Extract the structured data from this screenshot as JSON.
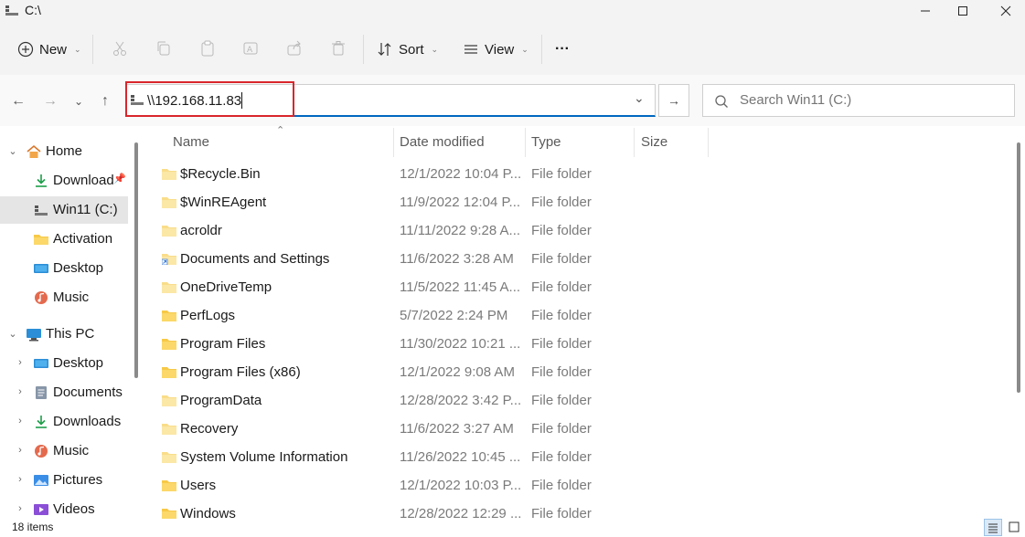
{
  "window": {
    "title": "C:\\"
  },
  "toolbar": {
    "new_label": "New",
    "sort_label": "Sort",
    "view_label": "View",
    "more_label": "···"
  },
  "address": {
    "value": "\\\\192.168.11.83",
    "go_label": "→"
  },
  "search": {
    "placeholder": "Search Win11 (C:)"
  },
  "sidebar": {
    "items": [
      {
        "label": "Home",
        "icon": "home-icon"
      },
      {
        "label": "Downloads",
        "icon": "download-icon",
        "pinned": true
      },
      {
        "label": "Win11 (C:)",
        "icon": "drive-icon",
        "selected": true
      },
      {
        "label": "Activation",
        "icon": "folder-icon"
      },
      {
        "label": "Desktop",
        "icon": "desktop-icon"
      },
      {
        "label": "Music",
        "icon": "music-icon"
      },
      {
        "label": "This PC",
        "icon": "pc-icon"
      },
      {
        "label": "Desktop",
        "icon": "desktop-icon"
      },
      {
        "label": "Documents",
        "icon": "documents-icon"
      },
      {
        "label": "Downloads",
        "icon": "download-icon"
      },
      {
        "label": "Music",
        "icon": "music-icon"
      },
      {
        "label": "Pictures",
        "icon": "pictures-icon"
      },
      {
        "label": "Videos",
        "icon": "videos-icon"
      }
    ]
  },
  "columns": {
    "name": "Name",
    "date": "Date modified",
    "type": "Type",
    "size": "Size"
  },
  "files": [
    {
      "name": "$Recycle.Bin",
      "date": "12/1/2022 10:04 P...",
      "type": "File folder",
      "faded": true
    },
    {
      "name": "$WinREAgent",
      "date": "11/9/2022 12:04 P...",
      "type": "File folder",
      "faded": true
    },
    {
      "name": "acroldr",
      "date": "11/11/2022 9:28 A...",
      "type": "File folder",
      "faded": true
    },
    {
      "name": "Documents and Settings",
      "date": "11/6/2022 3:28 AM",
      "type": "File folder",
      "faded": true,
      "shortcut": true
    },
    {
      "name": "OneDriveTemp",
      "date": "11/5/2022 11:45 A...",
      "type": "File folder",
      "faded": true
    },
    {
      "name": "PerfLogs",
      "date": "5/7/2022 2:24 PM",
      "type": "File folder"
    },
    {
      "name": "Program Files",
      "date": "11/30/2022 10:21 ...",
      "type": "File folder"
    },
    {
      "name": "Program Files (x86)",
      "date": "12/1/2022 9:08 AM",
      "type": "File folder"
    },
    {
      "name": "ProgramData",
      "date": "12/28/2022 3:42 P...",
      "type": "File folder",
      "faded": true
    },
    {
      "name": "Recovery",
      "date": "11/6/2022 3:27 AM",
      "type": "File folder",
      "faded": true
    },
    {
      "name": "System Volume Information",
      "date": "11/26/2022 10:45 ...",
      "type": "File folder",
      "faded": true
    },
    {
      "name": "Users",
      "date": "12/1/2022 10:03 P...",
      "type": "File folder"
    },
    {
      "name": "Windows",
      "date": "12/28/2022 12:29 ...",
      "type": "File folder"
    }
  ],
  "status": {
    "count": "18 items"
  },
  "colors": {
    "accent": "#0067c0",
    "highlight": "#d9262b",
    "folder": "#f7c948",
    "selected_bg": "#e5e5e5"
  }
}
